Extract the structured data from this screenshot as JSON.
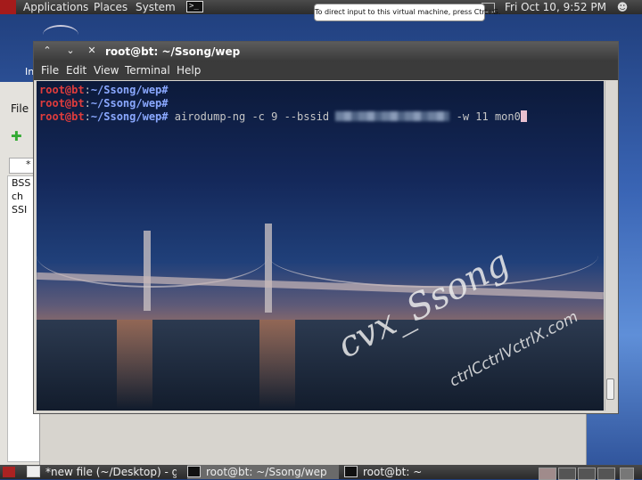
{
  "top_panel": {
    "menus": [
      "Applications",
      "Places",
      "System"
    ],
    "clock": "Fri Oct 10,  9:52 PM",
    "icons": [
      "backtrack-logo-icon",
      "terminal-launcher-icon",
      "mail-icon",
      "user-icon"
    ]
  },
  "tooltip": "To direct input to this virtual machine, press Ctrl+G.",
  "desktop": {
    "label_fragment": "In"
  },
  "gedit": {
    "menu_file": "File",
    "tab_label": "*",
    "lines": [
      "BSS",
      "ch",
      "SSI"
    ]
  },
  "terminal": {
    "title": "root@bt: ~/Ssong/wep",
    "menu": [
      "File",
      "Edit",
      "View",
      "Terminal",
      "Help"
    ],
    "lines": [
      {
        "user": "root@bt",
        "sep": ":",
        "path": "~/Ssong/wep",
        "prompt": "#",
        "cmd_a": "",
        "cmd_b": ""
      },
      {
        "user": "root@bt",
        "sep": ":",
        "path": "~/Ssong/wep",
        "prompt": "#",
        "cmd_a": "",
        "cmd_b": ""
      },
      {
        "user": "root@bt",
        "sep": ":",
        "path": "~/Ssong/wep",
        "prompt": "#",
        "cmd_a": " airodump-ng -c 9 --bssid ",
        "cmd_b": " -w 11 mon0"
      }
    ],
    "watermark_main": "cvx_Ssong",
    "watermark_site": "ctrlCctrlVctrlX.com"
  },
  "taskbar": {
    "tasks": [
      {
        "label": "*new file (~/Desktop) - gedit",
        "active": false
      },
      {
        "label": "root@bt: ~/Ssong/wep",
        "active": true
      },
      {
        "label": "root@bt: ~",
        "active": false
      }
    ]
  },
  "colors": {
    "prompt_user": "#e03c3c",
    "prompt_path": "#8aa8ff",
    "panel": "#3a3a3a"
  }
}
